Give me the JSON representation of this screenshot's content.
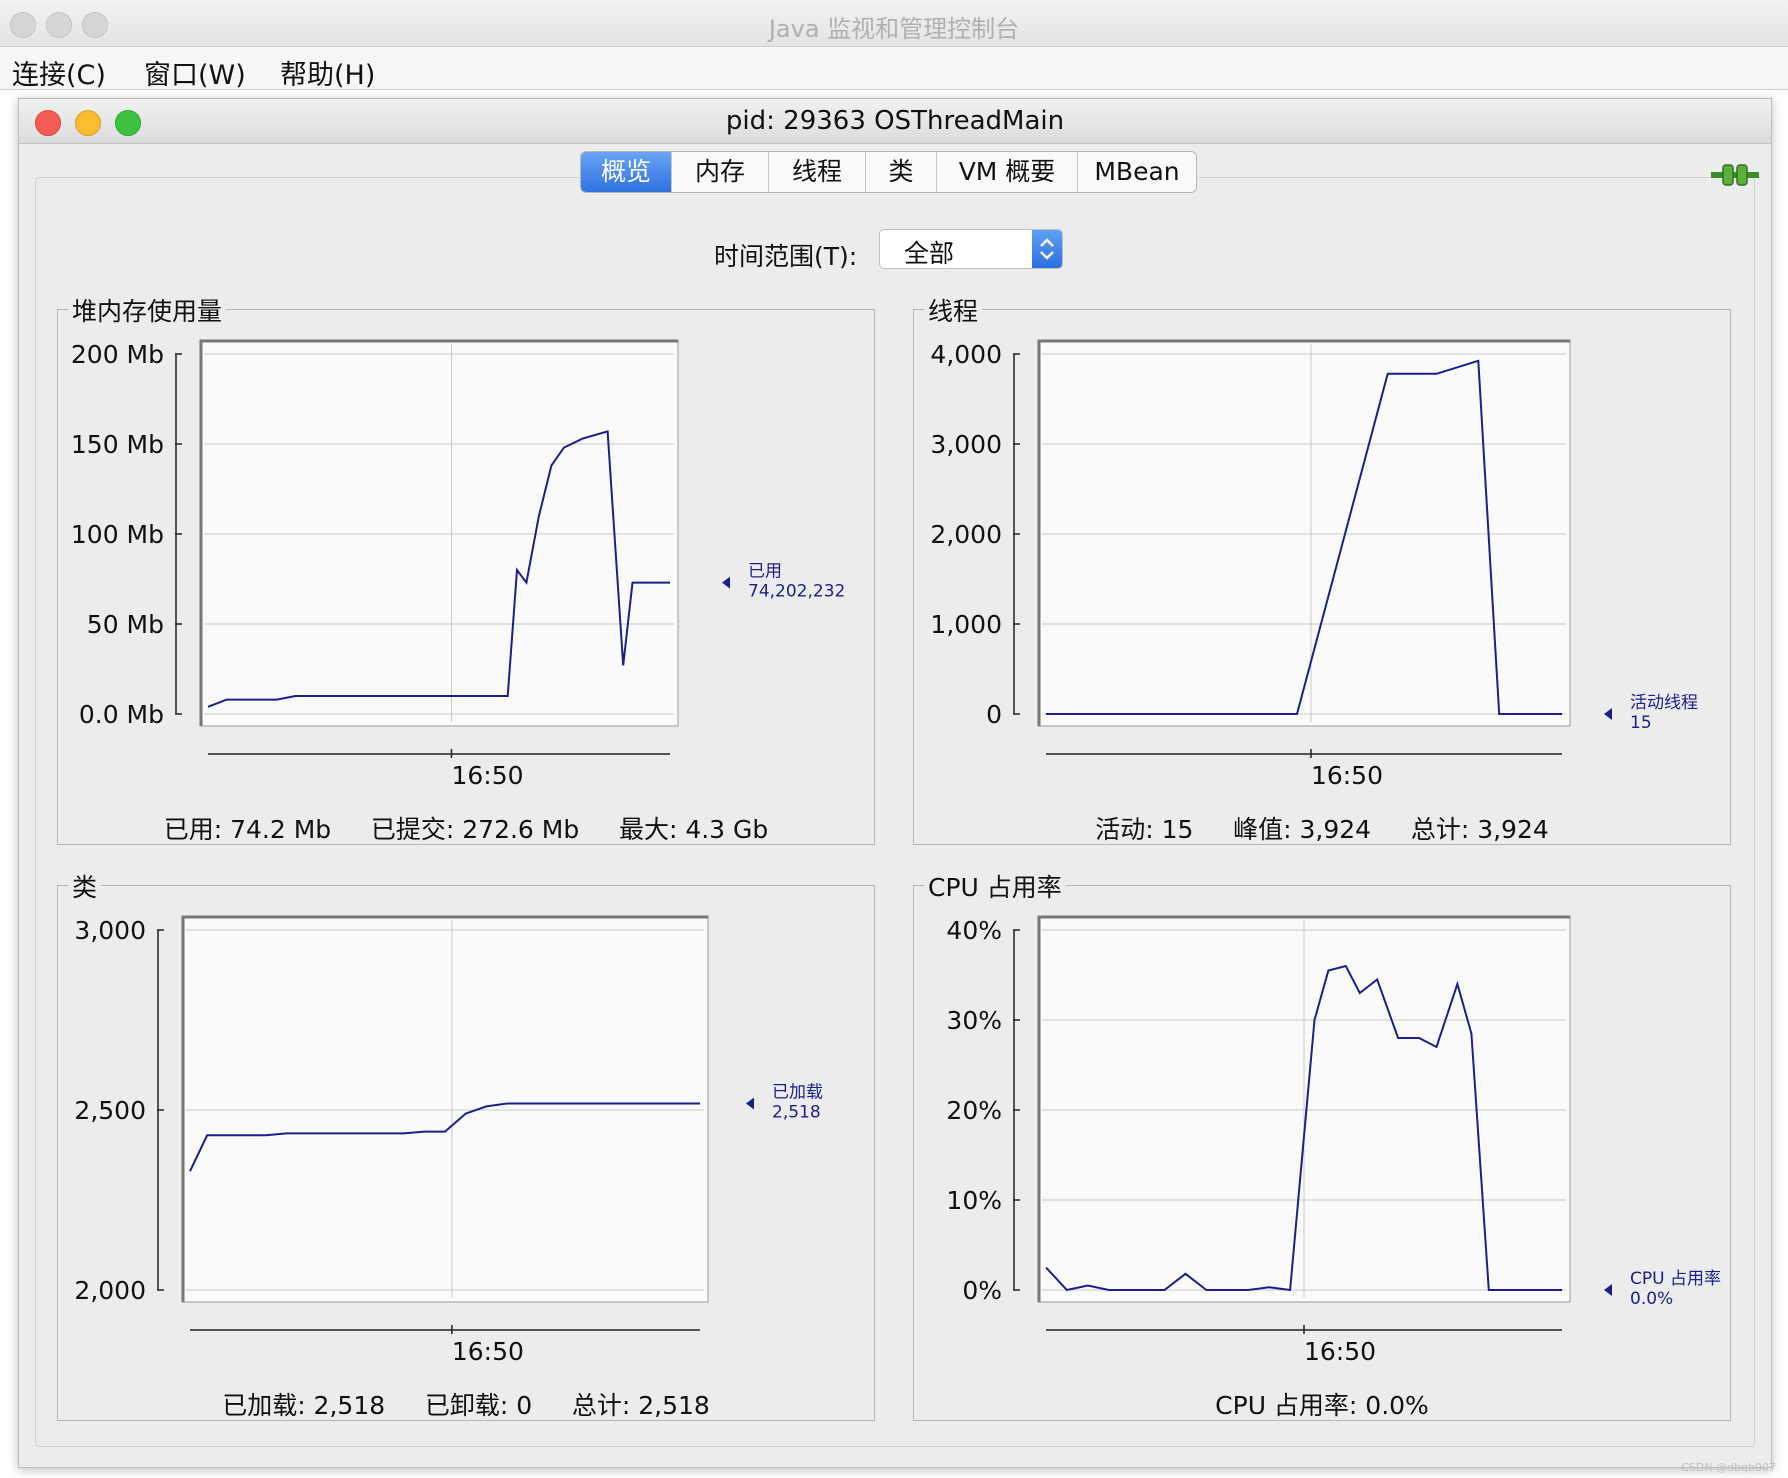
{
  "app": {
    "title": "Java 监视和管理控制台",
    "menu": [
      "连接(C)",
      "窗口(W)",
      "帮助(H)"
    ]
  },
  "window": {
    "title": "pid: 29363 OSThreadMain"
  },
  "tabs": [
    {
      "label": "概览",
      "active": true
    },
    {
      "label": "内存",
      "active": false
    },
    {
      "label": "线程",
      "active": false
    },
    {
      "label": "类",
      "active": false
    },
    {
      "label": "VM 概要",
      "active": false
    },
    {
      "label": "MBean",
      "active": false
    }
  ],
  "time_range": {
    "label": "时间范围(T):",
    "value": "全部"
  },
  "colors": {
    "series": "#1a1f8c",
    "grid": "#c9c9c9",
    "plot_bg": "#fafafa",
    "tab_active": "#2f72e0"
  },
  "icons": [
    "connection-plug-icon",
    "select-arrows-icon",
    "legend-marker-icon"
  ],
  "panels": {
    "heap": {
      "title": "堆内存使用量",
      "stats": "已用: 74.2 Mb     已提交: 272.6 Mb     最大: 4.3 Gb",
      "legend_label": "已用",
      "legend_value": "74,202,232"
    },
    "threads": {
      "title": "线程",
      "stats": "活动: 15     峰值: 3,924     总计: 3,924",
      "legend_label": "活动线程",
      "legend_value": "15"
    },
    "classes": {
      "title": "类",
      "stats": "已加载: 2,518     已卸载: 0     总计: 2,518",
      "legend_label": "已加载",
      "legend_value": "2,518"
    },
    "cpu": {
      "title": "CPU 占用率",
      "stats": "CPU 占用率: 0.0%",
      "legend_label": "CPU 占用率",
      "legend_value": "0.0%"
    }
  },
  "chart_data": [
    {
      "id": "heap",
      "type": "line",
      "title": "堆内存使用量",
      "ylim": [
        0,
        200
      ],
      "yticks": [
        "200 Mb",
        "150 Mb",
        "100 Mb",
        "50 Mb",
        "0.0 Mb"
      ],
      "ytick_values": [
        200,
        150,
        100,
        50,
        0
      ],
      "xtick_label": "16:50",
      "x": [
        0,
        0.3,
        1.1,
        1.4,
        2.5,
        4.8,
        4.95,
        5.1,
        5.3,
        5.5,
        5.7,
        6.0,
        6.4,
        6.65,
        6.8,
        7.0,
        7.4
      ],
      "values": [
        4,
        8,
        8,
        10,
        10,
        10,
        80,
        73,
        110,
        138,
        148,
        153,
        157,
        27,
        73,
        73,
        73
      ],
      "xlim": [
        0,
        7.4
      ],
      "xtick_at": 3.9,
      "series_name": "已用"
    },
    {
      "id": "threads",
      "type": "line",
      "title": "线程",
      "ylim": [
        0,
        4000
      ],
      "yticks": [
        "4,000",
        "3,000",
        "2,000",
        "1,000",
        "0"
      ],
      "ytick_values": [
        4000,
        3000,
        2000,
        1000,
        0
      ],
      "xtick_label": "16:50",
      "x": [
        0,
        3.6,
        4.9,
        5.6,
        6.2,
        6.5,
        7.4
      ],
      "values": [
        0,
        0,
        3780,
        3780,
        3924,
        0,
        0
      ],
      "xlim": [
        0,
        7.4
      ],
      "xtick_at": 3.8,
      "series_name": "活动线程"
    },
    {
      "id": "classes",
      "type": "line",
      "title": "类",
      "ylim": [
        2000,
        3000
      ],
      "yticks": [
        "3,000",
        "2,500",
        "2,000"
      ],
      "ytick_values": [
        3000,
        2500,
        2000
      ],
      "xtick_label": "16:50",
      "x": [
        0,
        0.25,
        1.1,
        1.4,
        3.1,
        3.4,
        3.7,
        4.0,
        4.3,
        4.6,
        7.4
      ],
      "values": [
        2330,
        2430,
        2430,
        2435,
        2435,
        2440,
        2440,
        2490,
        2510,
        2518,
        2518
      ],
      "xlim": [
        0,
        7.4
      ],
      "xtick_at": 3.8,
      "series_name": "已加载"
    },
    {
      "id": "cpu",
      "type": "line",
      "title": "CPU 占用率",
      "ylim": [
        0,
        40
      ],
      "yticks": [
        "40%",
        "30%",
        "20%",
        "10%",
        "0%"
      ],
      "ytick_values": [
        40,
        30,
        20,
        10,
        0
      ],
      "xtick_label": "16:50",
      "x": [
        0,
        0.3,
        0.6,
        0.9,
        1.7,
        2.0,
        2.3,
        2.9,
        3.2,
        3.5,
        3.85,
        4.05,
        4.3,
        4.5,
        4.75,
        5.05,
        5.35,
        5.6,
        5.9,
        6.1,
        6.35,
        6.85,
        7.4
      ],
      "values": [
        2.5,
        0,
        0.5,
        0,
        0,
        1.8,
        0,
        0,
        0.3,
        0,
        30,
        35.5,
        36,
        33,
        34.5,
        28,
        28,
        27,
        34,
        28.5,
        0,
        0,
        0
      ],
      "xlim": [
        0,
        7.4
      ],
      "xtick_at": 3.7,
      "series_name": "CPU 占用率"
    }
  ],
  "watermark": "CSDN @dbqb007"
}
